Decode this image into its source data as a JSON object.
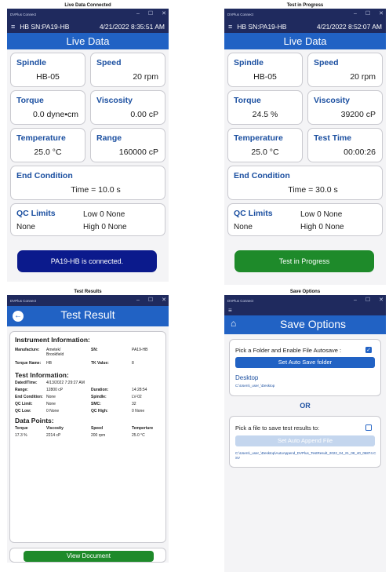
{
  "window": {
    "app_name": "DVPlus Connect",
    "minimize": "–",
    "maximize": "☐",
    "close": "✕"
  },
  "panel1": {
    "caption": "Live Data Connected",
    "status": {
      "menu": "≡",
      "sn": "HB  SN:PA19-HB",
      "datetime": "4/21/2022 8:35:51 AM"
    },
    "title": "Live Data",
    "spindle": {
      "label": "Spindle",
      "value": "HB-05"
    },
    "speed": {
      "label": "Speed",
      "value": "20 rpm"
    },
    "torque": {
      "label": "Torque",
      "value": "0.0 dyne•cm"
    },
    "viscosity": {
      "label": "Viscosity",
      "value": "0.00 cP"
    },
    "temperature": {
      "label": "Temperature",
      "value": "25.0 °C"
    },
    "range": {
      "label": "Range",
      "value": "160000 cP"
    },
    "end_condition": {
      "label": "End Condition",
      "value": "Time = 10.0 s"
    },
    "qc": {
      "label": "QC Limits",
      "low": "Low  0  None",
      "none": "None",
      "high": "High 0  None"
    },
    "button": "PA19-HB is connected."
  },
  "panel2": {
    "caption": "Test in Progress",
    "status": {
      "menu": "≡",
      "sn": "HB  SN:PA19-HB",
      "datetime": "4/21/2022 8:52:07 AM"
    },
    "title": "Live Data",
    "spindle": {
      "label": "Spindle",
      "value": "HB-05"
    },
    "speed": {
      "label": "Speed",
      "value": "20 rpm"
    },
    "torque": {
      "label": "Torque",
      "value": "24.5 %"
    },
    "viscosity": {
      "label": "Viscosity",
      "value": "39200 cP"
    },
    "temperature": {
      "label": "Temperature",
      "value": "25.0 °C"
    },
    "test_time": {
      "label": "Test Time",
      "value": "00:00:26"
    },
    "end_condition": {
      "label": "End Condition",
      "value": "Time = 30.0 s"
    },
    "qc": {
      "label": "QC Limits",
      "low": "Low  0  None",
      "none": "None",
      "high": "High 0  None"
    },
    "button": "Test in Progress"
  },
  "panel3": {
    "caption": "Test Results",
    "back": "←",
    "title": "Test Result",
    "instrument": {
      "heading": "Instrument Information:",
      "manufacture_label": "Manufacture:",
      "manufacture_value": "Ametek/ Brookfield",
      "sn_label": "SN:",
      "sn_value": "PA19-HB",
      "torque_name_label": "Torque Name:",
      "torque_name_value": "HB",
      "tk_label": "TK Value:",
      "tk_value": "8"
    },
    "test": {
      "heading": "Test Information:",
      "rows": [
        {
          "k1": "Dated/Time:",
          "v1": "4/13/2022 7:29:27 AM",
          "k2": "",
          "v2": ""
        },
        {
          "k1": "Range:",
          "v1": "12800 cP",
          "k2": "Duration:",
          "v2": "14:28:54"
        },
        {
          "k1": "End Condition:",
          "v1": "None",
          "k2": "Spindle:",
          "v2": "LV-02"
        },
        {
          "k1": "QC Limit:",
          "v1": "None",
          "k2": "SMC:",
          "v2": "32"
        },
        {
          "k1": "QC Low:",
          "v1": "0  None",
          "k2": "QC High:",
          "v2": "0  None"
        }
      ]
    },
    "data_points": {
      "heading": "Data Points:",
      "headers": [
        "Torque",
        "Viscosity",
        "Speed",
        "Temperture"
      ],
      "row": [
        "17.3 %",
        "2214 cP",
        "200 rpm",
        "25.0 °C"
      ]
    },
    "button": "View Document"
  },
  "panel4": {
    "caption": "Save Options",
    "menu": "≡",
    "home": "⌂",
    "title": "Save Options",
    "autosave_label": "Pick a Folder and Enable File Autosave :",
    "autosave_checked": true,
    "set_folder_button": "Set Auto Save folder",
    "folder_name": "Desktop",
    "folder_path": "C:\\Users\\_user_\\Desktop",
    "or": "OR",
    "file_label": "Pick a file to save test results to:",
    "file_checked": false,
    "append_button": "Set Auto Append File",
    "file_path": "C:\\Users\\_user_\\Desktop\\AutoAppend_DVPlus_TestResult_2022_04_21_08_40_06874.CSV"
  },
  "colors": {
    "navy": "#1f2a5e",
    "blue": "#2162c4",
    "label_blue": "#1b4fa0",
    "connected": "#0b1a8c",
    "progress": "#1e8a2a",
    "light_button": "#c4d6ee"
  }
}
